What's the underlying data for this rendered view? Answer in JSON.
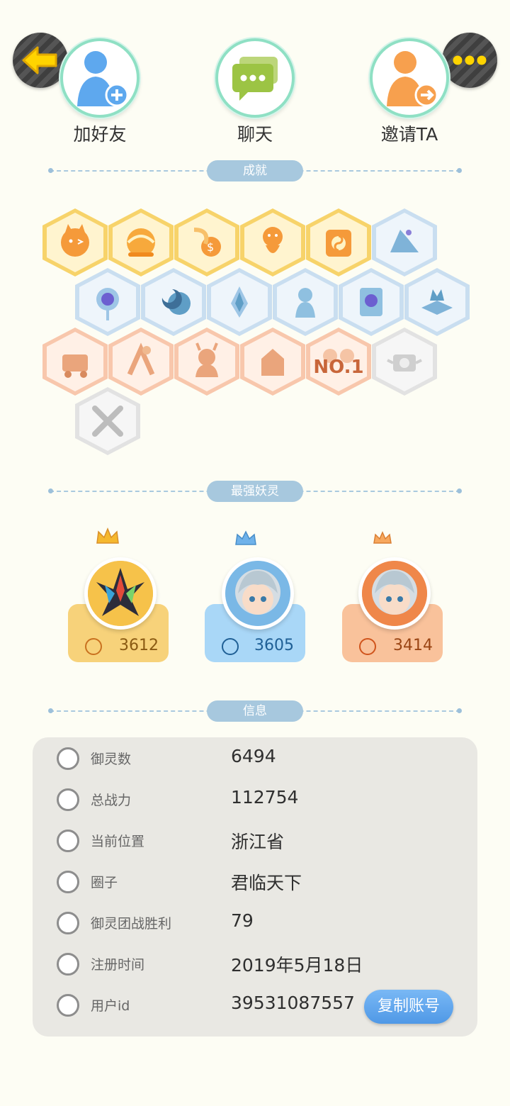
{
  "top": {
    "add_friend_label": "加好友",
    "chat_label": "聊天",
    "invite_label": "邀请TA"
  },
  "sections": {
    "achievements": "成就",
    "strongest": "最强妖灵",
    "info": "信息"
  },
  "achievements": [
    {
      "name": "badge-1",
      "tier": "gold"
    },
    {
      "name": "badge-2",
      "tier": "gold"
    },
    {
      "name": "badge-3",
      "tier": "gold"
    },
    {
      "name": "badge-4",
      "tier": "gold"
    },
    {
      "name": "badge-5",
      "tier": "gold"
    },
    {
      "name": "badge-6",
      "tier": "blue"
    },
    {
      "name": "badge-7",
      "tier": "blue"
    },
    {
      "name": "badge-8",
      "tier": "blue"
    },
    {
      "name": "badge-9",
      "tier": "blue"
    },
    {
      "name": "badge-10",
      "tier": "blue"
    },
    {
      "name": "badge-11",
      "tier": "blue"
    },
    {
      "name": "badge-12",
      "tier": "blue"
    },
    {
      "name": "badge-13",
      "tier": "peach"
    },
    {
      "name": "badge-14",
      "tier": "peach"
    },
    {
      "name": "badge-15",
      "tier": "peach"
    },
    {
      "name": "badge-16",
      "tier": "peach"
    },
    {
      "name": "badge-17",
      "tier": "peach",
      "text": "NO.1"
    },
    {
      "name": "badge-18",
      "tier": "grey"
    },
    {
      "name": "badge-19",
      "tier": "grey"
    }
  ],
  "yaoling": [
    {
      "power": "3612",
      "color": "#f7d27a",
      "text_color": "#8a5a12"
    },
    {
      "power": "3605",
      "color": "#a9d7f7",
      "text_color": "#1f5f95"
    },
    {
      "power": "3414",
      "color": "#f9c29b",
      "text_color": "#9a4514"
    }
  ],
  "info": {
    "rows": [
      {
        "key": "御灵数",
        "value": "6494",
        "icon": "spirit-count-icon"
      },
      {
        "key": "总战力",
        "value": "112754",
        "icon": "sword-icon"
      },
      {
        "key": "当前位置",
        "value": "浙江省",
        "icon": "location-icon"
      },
      {
        "key": "圈子",
        "value": "君临天下",
        "icon": "circle-icon"
      },
      {
        "key": "御灵团战胜利",
        "value": "79",
        "icon": "anchor-icon"
      },
      {
        "key": "注册时间",
        "value": "2019年5月18日",
        "icon": "clock-icon"
      },
      {
        "key": "用户id",
        "value": "39531087557",
        "icon": "id-card-icon"
      }
    ],
    "copy_button": "复制账号"
  }
}
